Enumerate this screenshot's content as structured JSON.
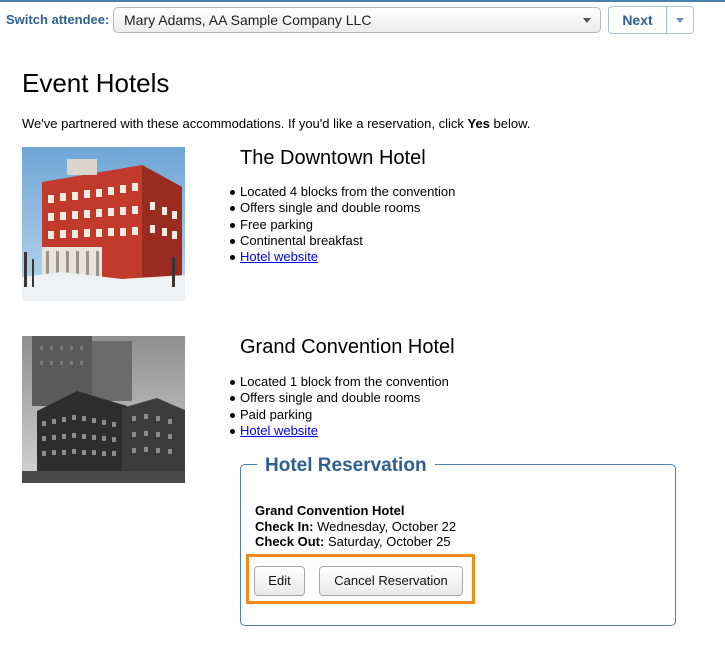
{
  "header": {
    "switch_label": "Switch attendee:",
    "attendee_selected": "Mary Adams, AA Sample Company LLC",
    "next_label": "Next"
  },
  "page": {
    "title": "Event Hotels",
    "intro_before": "We've partnered with these accommodations. If you'd like a reservation, click ",
    "intro_bold": "Yes",
    "intro_after": " below."
  },
  "hotels": [
    {
      "name": "The Downtown Hotel",
      "features": [
        "Located 4 blocks from the convention",
        "Offers single and double rooms",
        "Free parking",
        "Continental breakfast"
      ],
      "link": "Hotel website"
    },
    {
      "name": "Grand Convention Hotel",
      "features": [
        "Located 1 block from the convention",
        "Offers single and double rooms",
        "Paid parking"
      ],
      "link": "Hotel website"
    }
  ],
  "reservation": {
    "legend": "Hotel Reservation",
    "hotel": "Grand Convention Hotel",
    "checkin_label": "Check In:",
    "checkin_value": " Wednesday, October 22",
    "checkout_label": "Check Out:",
    "checkout_value": " Saturday, October 25",
    "edit_label": "Edit",
    "cancel_label": "Cancel Reservation"
  },
  "colors": {
    "accent": "#2f5f8f",
    "highlight": "#f28a1a",
    "link": "#0000ee"
  }
}
